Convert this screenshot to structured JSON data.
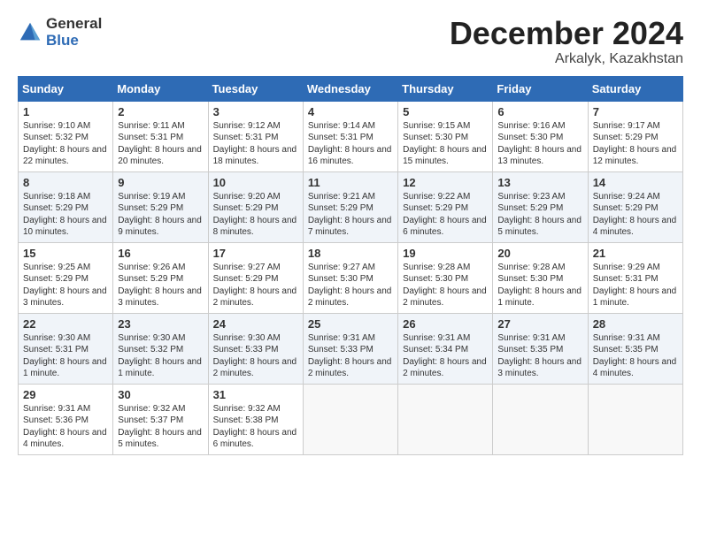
{
  "logo": {
    "general": "General",
    "blue": "Blue"
  },
  "title": {
    "month": "December 2024",
    "location": "Arkalyk, Kazakhstan"
  },
  "days_of_week": [
    "Sunday",
    "Monday",
    "Tuesday",
    "Wednesday",
    "Thursday",
    "Friday",
    "Saturday"
  ],
  "weeks": [
    [
      {
        "day": "1",
        "sunrise": "9:10 AM",
        "sunset": "5:32 PM",
        "daylight": "8 hours and 22 minutes."
      },
      {
        "day": "2",
        "sunrise": "9:11 AM",
        "sunset": "5:31 PM",
        "daylight": "8 hours and 20 minutes."
      },
      {
        "day": "3",
        "sunrise": "9:12 AM",
        "sunset": "5:31 PM",
        "daylight": "8 hours and 18 minutes."
      },
      {
        "day": "4",
        "sunrise": "9:14 AM",
        "sunset": "5:31 PM",
        "daylight": "8 hours and 16 minutes."
      },
      {
        "day": "5",
        "sunrise": "9:15 AM",
        "sunset": "5:30 PM",
        "daylight": "8 hours and 15 minutes."
      },
      {
        "day": "6",
        "sunrise": "9:16 AM",
        "sunset": "5:30 PM",
        "daylight": "8 hours and 13 minutes."
      },
      {
        "day": "7",
        "sunrise": "9:17 AM",
        "sunset": "5:29 PM",
        "daylight": "8 hours and 12 minutes."
      }
    ],
    [
      {
        "day": "8",
        "sunrise": "9:18 AM",
        "sunset": "5:29 PM",
        "daylight": "8 hours and 10 minutes."
      },
      {
        "day": "9",
        "sunrise": "9:19 AM",
        "sunset": "5:29 PM",
        "daylight": "8 hours and 9 minutes."
      },
      {
        "day": "10",
        "sunrise": "9:20 AM",
        "sunset": "5:29 PM",
        "daylight": "8 hours and 8 minutes."
      },
      {
        "day": "11",
        "sunrise": "9:21 AM",
        "sunset": "5:29 PM",
        "daylight": "8 hours and 7 minutes."
      },
      {
        "day": "12",
        "sunrise": "9:22 AM",
        "sunset": "5:29 PM",
        "daylight": "8 hours and 6 minutes."
      },
      {
        "day": "13",
        "sunrise": "9:23 AM",
        "sunset": "5:29 PM",
        "daylight": "8 hours and 5 minutes."
      },
      {
        "day": "14",
        "sunrise": "9:24 AM",
        "sunset": "5:29 PM",
        "daylight": "8 hours and 4 minutes."
      }
    ],
    [
      {
        "day": "15",
        "sunrise": "9:25 AM",
        "sunset": "5:29 PM",
        "daylight": "8 hours and 3 minutes."
      },
      {
        "day": "16",
        "sunrise": "9:26 AM",
        "sunset": "5:29 PM",
        "daylight": "8 hours and 3 minutes."
      },
      {
        "day": "17",
        "sunrise": "9:27 AM",
        "sunset": "5:29 PM",
        "daylight": "8 hours and 2 minutes."
      },
      {
        "day": "18",
        "sunrise": "9:27 AM",
        "sunset": "5:30 PM",
        "daylight": "8 hours and 2 minutes."
      },
      {
        "day": "19",
        "sunrise": "9:28 AM",
        "sunset": "5:30 PM",
        "daylight": "8 hours and 2 minutes."
      },
      {
        "day": "20",
        "sunrise": "9:28 AM",
        "sunset": "5:30 PM",
        "daylight": "8 hours and 1 minute."
      },
      {
        "day": "21",
        "sunrise": "9:29 AM",
        "sunset": "5:31 PM",
        "daylight": "8 hours and 1 minute."
      }
    ],
    [
      {
        "day": "22",
        "sunrise": "9:30 AM",
        "sunset": "5:31 PM",
        "daylight": "8 hours and 1 minute."
      },
      {
        "day": "23",
        "sunrise": "9:30 AM",
        "sunset": "5:32 PM",
        "daylight": "8 hours and 1 minute."
      },
      {
        "day": "24",
        "sunrise": "9:30 AM",
        "sunset": "5:33 PM",
        "daylight": "8 hours and 2 minutes."
      },
      {
        "day": "25",
        "sunrise": "9:31 AM",
        "sunset": "5:33 PM",
        "daylight": "8 hours and 2 minutes."
      },
      {
        "day": "26",
        "sunrise": "9:31 AM",
        "sunset": "5:34 PM",
        "daylight": "8 hours and 2 minutes."
      },
      {
        "day": "27",
        "sunrise": "9:31 AM",
        "sunset": "5:35 PM",
        "daylight": "8 hours and 3 minutes."
      },
      {
        "day": "28",
        "sunrise": "9:31 AM",
        "sunset": "5:35 PM",
        "daylight": "8 hours and 4 minutes."
      }
    ],
    [
      {
        "day": "29",
        "sunrise": "9:31 AM",
        "sunset": "5:36 PM",
        "daylight": "8 hours and 4 minutes."
      },
      {
        "day": "30",
        "sunrise": "9:32 AM",
        "sunset": "5:37 PM",
        "daylight": "8 hours and 5 minutes."
      },
      {
        "day": "31",
        "sunrise": "9:32 AM",
        "sunset": "5:38 PM",
        "daylight": "8 hours and 6 minutes."
      },
      null,
      null,
      null,
      null
    ]
  ]
}
